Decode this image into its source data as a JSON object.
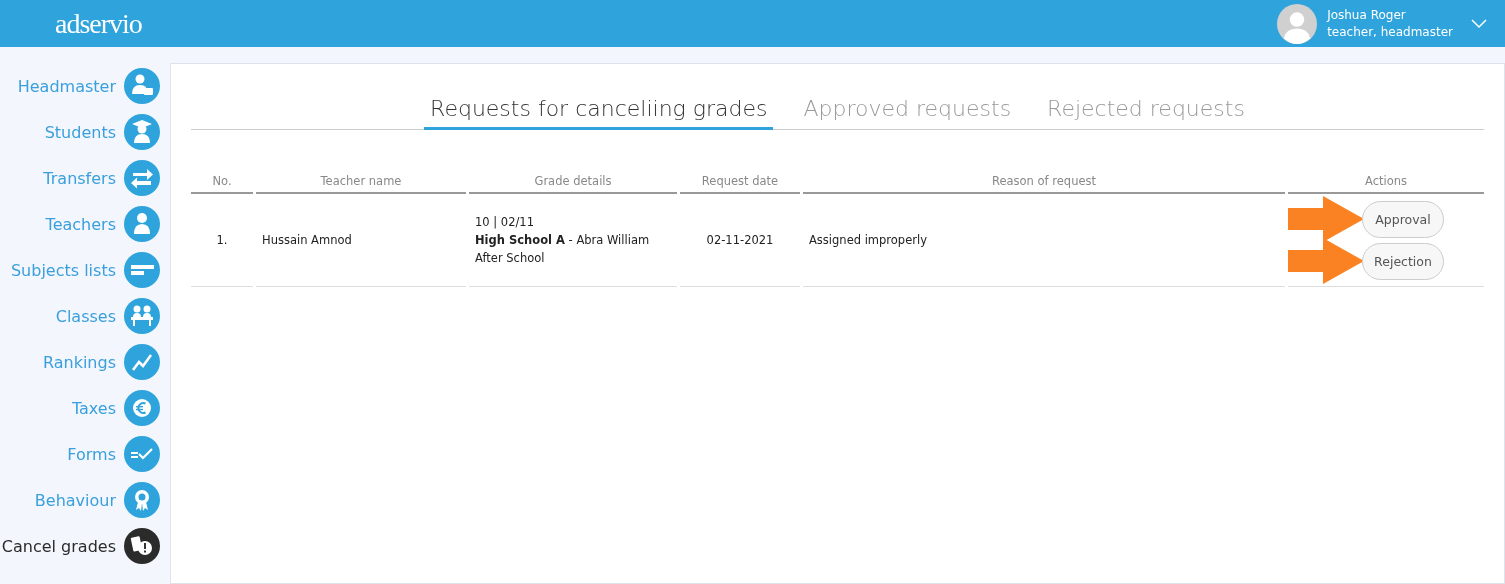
{
  "header": {
    "logo": "adservio",
    "user": {
      "name": "Joshua Roger",
      "role": "teacher, headmaster"
    }
  },
  "sidebar": {
    "items": [
      {
        "label": "Headmaster",
        "selected": false
      },
      {
        "label": "Students",
        "selected": false
      },
      {
        "label": "Transfers",
        "selected": false
      },
      {
        "label": "Teachers",
        "selected": false
      },
      {
        "label": "Subjects lists",
        "selected": false
      },
      {
        "label": "Classes",
        "selected": false
      },
      {
        "label": "Rankings",
        "selected": false
      },
      {
        "label": "Taxes",
        "selected": false
      },
      {
        "label": "Forms",
        "selected": false
      },
      {
        "label": "Behaviour",
        "selected": false
      },
      {
        "label": "Cancel grades",
        "selected": true
      }
    ]
  },
  "tabs": [
    {
      "label": "Requests for canceliing grades",
      "selected": true
    },
    {
      "label": "Approved requests",
      "selected": false
    },
    {
      "label": "Rejected requests",
      "selected": false
    }
  ],
  "table": {
    "columns": [
      "No.",
      "Teacher name",
      "Grade details",
      "Request date",
      "Reason of request",
      "Actions"
    ],
    "rows": [
      {
        "no": "1.",
        "teacher": "Hussain Amnod",
        "grade_details": [
          "10 | 02/11",
          "**High School A** - Abra William",
          "After School"
        ],
        "date": "02-11-2021",
        "reason": "Assigned improperly",
        "actions": [
          "Approval",
          "Rejection"
        ]
      }
    ]
  }
}
